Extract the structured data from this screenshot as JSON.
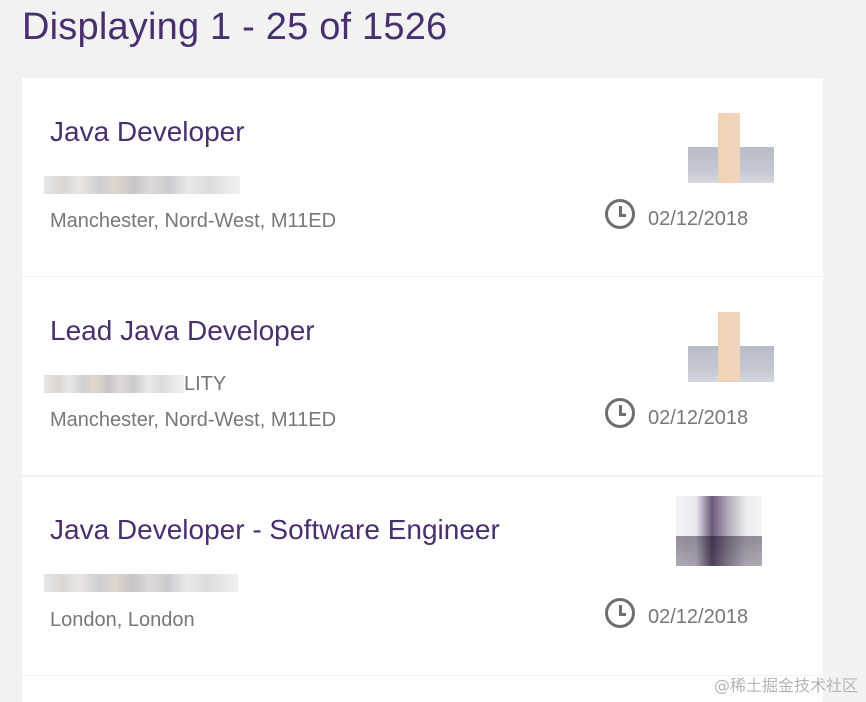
{
  "results": {
    "summary": "Displaying 1 - 25 of 1526"
  },
  "jobs": [
    {
      "title": "Java Developer",
      "company_suffix": "",
      "location": "Manchester, Nord-West, M11ED",
      "date": "02/12/2018",
      "logo_icon": "company-logo"
    },
    {
      "title": "Lead Java Developer",
      "company_suffix": "LITY",
      "location": "Manchester, Nord-West, M11ED",
      "date": "02/12/2018",
      "logo_icon": "company-logo"
    },
    {
      "title": "Java Developer - Software Engineer",
      "company_suffix": "",
      "location": "London, London",
      "date": "02/12/2018",
      "logo_icon": "company-logo"
    }
  ],
  "watermark": "@稀土掘金技术社区",
  "colors": {
    "title": "#4a2f6e",
    "muted_text": "#777777",
    "card_bg": "#ffffff",
    "page_bg": "#f2f2f2"
  }
}
